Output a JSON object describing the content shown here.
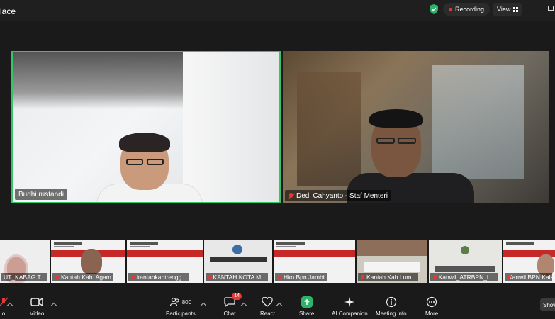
{
  "window": {
    "title": "lace"
  },
  "status": {
    "recording_label": "Recording",
    "view_label": "View"
  },
  "participants": [
    {
      "name": "Budhi rustandi",
      "muted": false
    },
    {
      "name": "Dedi Cahyanto - Staf Menteri",
      "muted": true
    }
  ],
  "thumbnails": [
    {
      "name": "UT_KABAG T..."
    },
    {
      "name": "Kantah Kab. Agam"
    },
    {
      "name": "kantahkabtrengg..."
    },
    {
      "name": "KANTAH KOTA M..."
    },
    {
      "name": "Hko Bpn Jambi"
    },
    {
      "name": "Kantah Kab Lum..."
    },
    {
      "name": "Kanwil_ATRBPN_L..."
    },
    {
      "name": "Kanwil BPN Kals..."
    }
  ],
  "toolbar": {
    "audio_label": "o",
    "video_label": "Video",
    "participants_label": "Participants",
    "participants_count": "800",
    "chat_label": "Chat",
    "chat_badge": "14",
    "react_label": "React",
    "share_label": "Share",
    "ai_label": "AI Companion",
    "info_label": "Meeting info",
    "more_label": "More",
    "show_label": "Show"
  },
  "colors": {
    "active_speaker": "#35c46a",
    "share": "#2db36a",
    "record": "#e53935"
  }
}
